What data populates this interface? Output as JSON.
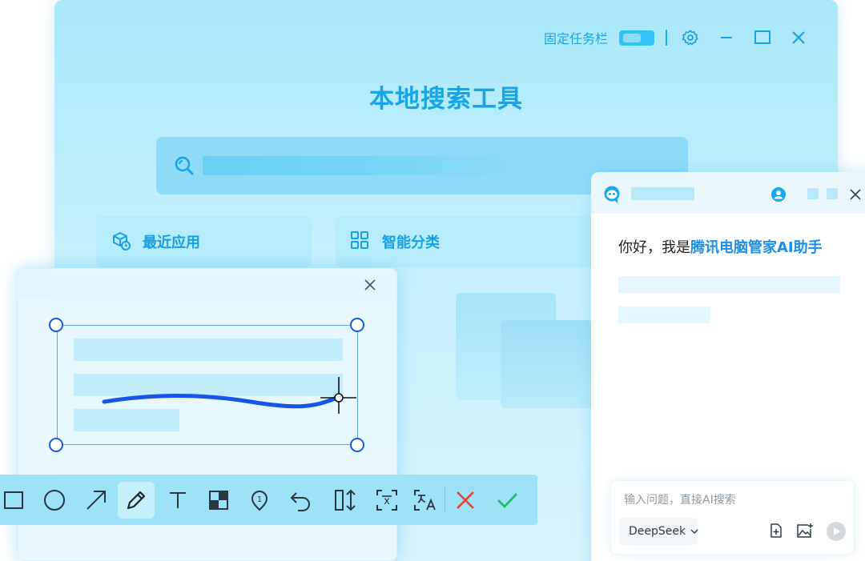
{
  "main": {
    "pin_taskbar_label": "固定任务栏",
    "app_title": "本地搜索工具",
    "cards": {
      "recent": "最近应用",
      "smart": "智能分类"
    }
  },
  "toolbar": {
    "tools": [
      "rectangle",
      "ellipse",
      "arrow",
      "pen",
      "text",
      "mosaic",
      "number-marker",
      "undo",
      "long-screenshot",
      "ocr",
      "translate",
      "cancel",
      "confirm"
    ],
    "active_tool": "pen"
  },
  "chat": {
    "greeting_prefix": "你好，我是",
    "greeting_highlight": "腾讯电脑管家AI助手",
    "input_placeholder": "输入问题，直接AI搜索",
    "model": "DeepSeek"
  },
  "colors": {
    "accent": "#16a6e6",
    "pen_stroke": "#1556e8",
    "cancel": "#ef3b36",
    "confirm": "#1fbf6a"
  }
}
